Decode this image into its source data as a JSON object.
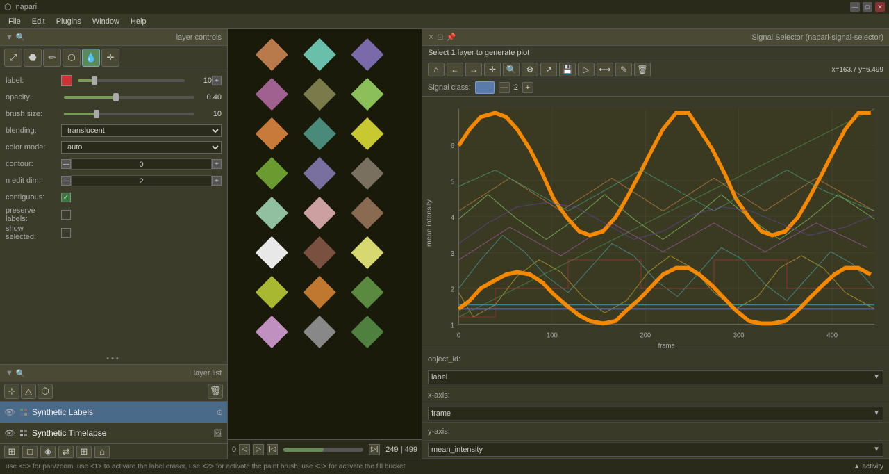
{
  "app": {
    "title": "napari",
    "window_controls": [
      "minimize",
      "maximize",
      "close"
    ]
  },
  "menubar": {
    "items": [
      "File",
      "Edit",
      "Plugins",
      "Window",
      "Help"
    ]
  },
  "layer_controls": {
    "title": "layer controls",
    "tools": [
      {
        "name": "transform",
        "icon": "⤢",
        "active": false
      },
      {
        "name": "fill",
        "icon": "⬣",
        "active": false
      },
      {
        "name": "picker",
        "icon": "✏",
        "active": false
      },
      {
        "name": "paint",
        "icon": "⬡",
        "active": false
      },
      {
        "name": "eyedropper",
        "icon": "💧",
        "active": true
      },
      {
        "name": "move",
        "icon": "✛",
        "active": false
      }
    ],
    "label_color": "#cc3333",
    "label_value": "10",
    "opacity": "0.40",
    "opacity_pct": 40,
    "brush_size": "10",
    "brush_size_pct": 25,
    "blending": "translucent",
    "color_mode": "auto",
    "contour": "0",
    "n_edit_dim": "2",
    "contiguous": true,
    "preserve_labels": false,
    "show_selected": false
  },
  "layer_list": {
    "title": "layer list",
    "layers": [
      {
        "name": "Synthetic Labels",
        "visible": true,
        "type": "labels",
        "active": true
      },
      {
        "name": "Synthetic Timelapse",
        "visible": true,
        "type": "image",
        "active": false
      }
    ]
  },
  "bottom_tools": {
    "icons": [
      "grid",
      "square",
      "layers",
      "expand",
      "grid-fill",
      "home"
    ]
  },
  "canvas": {
    "frame_current": "249",
    "frame_total": "499",
    "frame_pct": 50
  },
  "signal_selector": {
    "title": "Signal Selector (napari-signal-selector)",
    "prompt": "Select 1 layer to generate plot",
    "coords": "x=163.7 y=6.499",
    "toolbar": {
      "home": "⌂",
      "back": "←",
      "forward": "→",
      "pan": "✛",
      "zoom": "🔍",
      "configure": "⚙",
      "trend": "↗",
      "save": "💾",
      "select": "▷",
      "span": "⟷",
      "annotate": "✎",
      "delete": "🗑"
    },
    "signal_class_label": "Signal class:",
    "signal_class_value": "2",
    "chart": {
      "y_label": "mean intensity",
      "x_label": "frame",
      "y_min": 1,
      "y_max": 6,
      "x_ticks": [
        0,
        100,
        200,
        300,
        400
      ],
      "y_ticks": [
        1,
        2,
        3,
        4,
        5,
        6
      ]
    },
    "object_id_label": "object_id:",
    "x_axis_label": "x-axis:",
    "y_axis_label": "y-axis:",
    "object_id_value": "label",
    "x_axis_value": "frame",
    "y_axis_value": "mean_intensity"
  },
  "statusbar": {
    "text": "use <5> for pan/zoom, use <1> to activate the label eraser, use <2> for activate the paint brush, use <3> for activate the fill bucket"
  },
  "canvas_diamonds": [
    {
      "color": "#b87a4a",
      "col": 0,
      "row": 0
    },
    {
      "color": "#6abfaa",
      "col": 1,
      "row": 0
    },
    {
      "color": "#7a6aaa",
      "col": 2,
      "row": 0
    },
    {
      "color": "#a06090",
      "col": 0,
      "row": 1
    },
    {
      "color": "#7a7a4a",
      "col": 1,
      "row": 1
    },
    {
      "color": "#8abf5a",
      "col": 2,
      "row": 1
    },
    {
      "color": "#c87a3a",
      "col": 0,
      "row": 2
    },
    {
      "color": "#4a8a7a",
      "col": 1,
      "row": 2
    },
    {
      "color": "#c8c830",
      "col": 2,
      "row": 2
    },
    {
      "color": "#6a9a30",
      "col": 0,
      "row": 3
    },
    {
      "color": "#7a70a0",
      "col": 1,
      "row": 3
    },
    {
      "color": "#7a7060",
      "col": 2,
      "row": 3
    },
    {
      "color": "#90c0a0",
      "col": 0,
      "row": 4
    },
    {
      "color": "#cca0a0",
      "col": 1,
      "row": 4
    },
    {
      "color": "#8a6a50",
      "col": 2,
      "row": 4
    },
    {
      "color": "#e8e8e8",
      "col": 0,
      "row": 5
    },
    {
      "color": "#7a5040",
      "col": 1,
      "row": 5
    },
    {
      "color": "#d8d870",
      "col": 2,
      "row": 5
    },
    {
      "color": "#a8b830",
      "col": 0,
      "row": 6
    },
    {
      "color": "#c07830",
      "col": 1,
      "row": 6
    },
    {
      "color": "#5a8a40",
      "col": 2,
      "row": 6
    },
    {
      "color": "#c090c0",
      "col": 0,
      "row": 7
    },
    {
      "color": "#888888",
      "col": 1,
      "row": 7
    },
    {
      "color": "#508040",
      "col": 2,
      "row": 7
    }
  ]
}
